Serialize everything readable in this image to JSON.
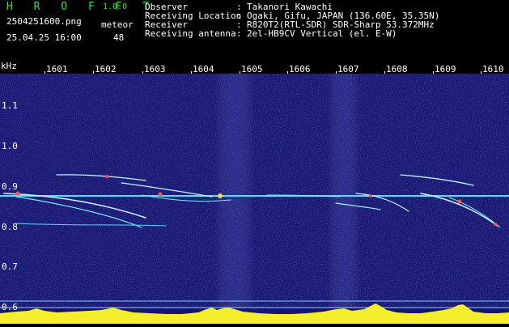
{
  "header": {
    "app_title": "H R O F F T",
    "version": "1.0.0",
    "file_name": "2504251600.png",
    "meteor_label": "meteor",
    "datetime": "25.04.25 16:00",
    "meteor_count": "48",
    "info": [
      {
        "key": "Observer",
        "sep": ":",
        "value": "Takanori Kawachi"
      },
      {
        "key": "Receiving Location",
        "sep": ":",
        "value": "Ogaki, Gifu, JAPAN (136.60E, 35.35N)"
      },
      {
        "key": "Receiver",
        "sep": ":",
        "value": "R820T2(RTL-SDR) SDR-Sharp 53.372MHz"
      },
      {
        "key": "Receiving antenna",
        "sep": ":",
        "value": "2el-HB9CV Vertical (el. E-W)"
      }
    ]
  },
  "axis": {
    "unit": "kHz",
    "x_ticks": [
      "1601",
      "1602",
      "1603",
      "1604",
      "1605",
      "1606",
      "1607",
      "1608",
      "1609",
      "1610"
    ],
    "y_ticks": [
      "1.1",
      "1.0",
      "0.9",
      "0.8",
      "0.7",
      "0.6"
    ]
  },
  "colors": {
    "header_title": "#2ee04a",
    "plot_background": "#16166e",
    "carrier_line": "#55ddff",
    "meteor_trace": "#c8f0ff",
    "meteor_head": "#ff5050",
    "histogram": "#f4ee2c",
    "baseline": "#8ec8ff"
  }
}
